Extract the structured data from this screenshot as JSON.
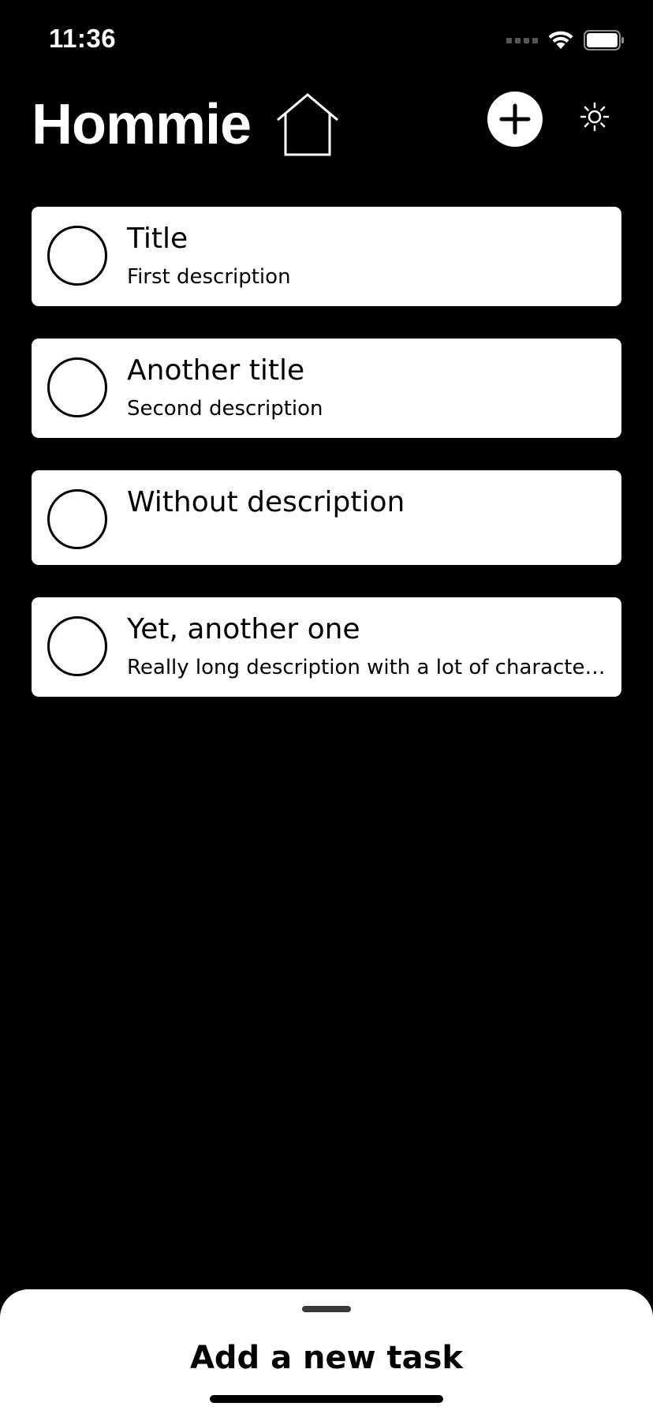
{
  "status_bar": {
    "time": "11:36"
  },
  "header": {
    "title": "Hommie",
    "icons": {
      "home": "home-icon",
      "add": "plus-icon",
      "theme": "sun-icon"
    }
  },
  "tasks": [
    {
      "title": "Title",
      "description": "First description"
    },
    {
      "title": "Another title",
      "description": "Second description"
    },
    {
      "title": "Without description",
      "description": ""
    },
    {
      "title": "Yet, another one",
      "description": "Really long description with a lot of character..."
    }
  ],
  "bottom_sheet": {
    "title": "Add a new task"
  },
  "colors": {
    "background": "#000000",
    "card": "#ffffff",
    "text_on_card": "#000000"
  }
}
